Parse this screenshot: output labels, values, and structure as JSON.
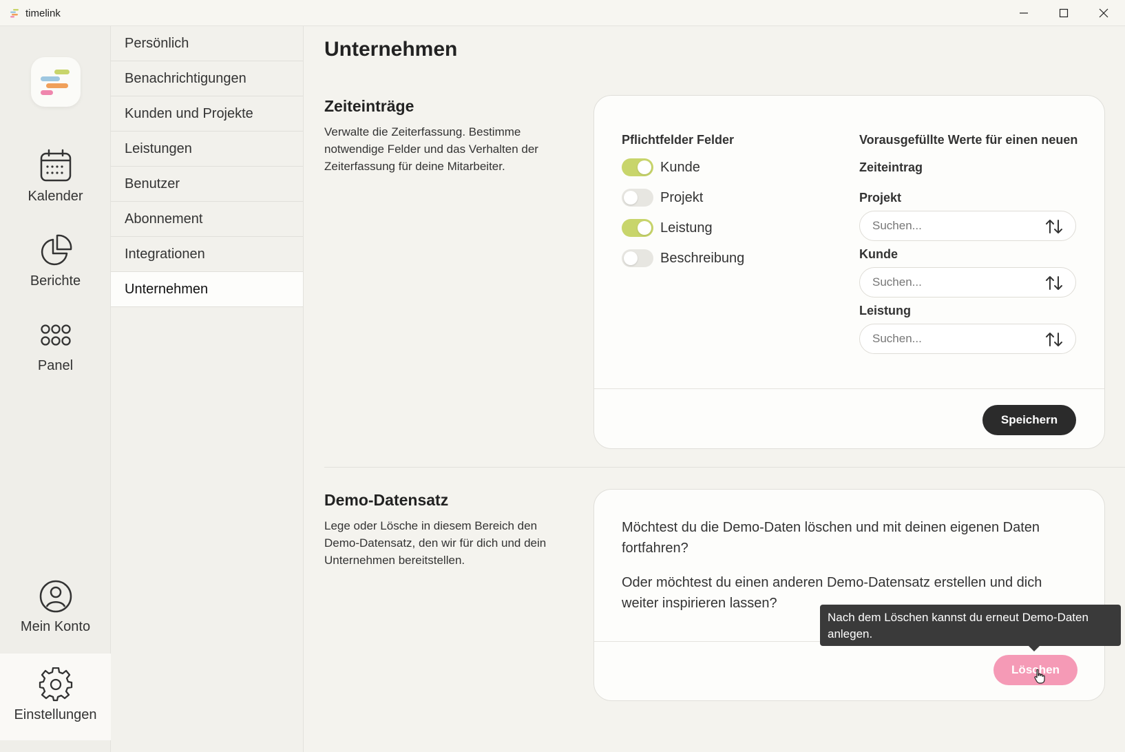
{
  "window": {
    "title": "timelink"
  },
  "rail": {
    "items": [
      {
        "label": "Kalender",
        "icon": "calendar-icon"
      },
      {
        "label": "Berichte",
        "icon": "pie-chart-icon"
      },
      {
        "label": "Panel",
        "icon": "grid-icon"
      },
      {
        "label": "Mein Konto",
        "icon": "user-circle-icon"
      },
      {
        "label": "Einstellungen",
        "icon": "gear-icon"
      }
    ]
  },
  "settings_nav": {
    "items": [
      "Persönlich",
      "Benachrichtigungen",
      "Kunden und Projekte",
      "Leistungen",
      "Benutzer",
      "Abonnement",
      "Integrationen",
      "Unternehmen"
    ],
    "active": "Unternehmen"
  },
  "main": {
    "title": "Unternehmen",
    "time_entries": {
      "title": "Zeiteinträge",
      "description": "Verwalte die Zeiterfassung. Bestimme notwendige Felder und das Verhalten der Zeiterfassung für deine Mitarbeiter.",
      "required_heading": "Pflichtfelder Felder",
      "toggles": [
        {
          "label": "Kunde",
          "on": true
        },
        {
          "label": "Projekt",
          "on": false
        },
        {
          "label": "Leistung",
          "on": true
        },
        {
          "label": "Beschreibung",
          "on": false
        }
      ],
      "prefill_heading_line1": "Vorausgefüllte Werte für einen neuen",
      "prefill_heading_line2": "Zeiteintrag",
      "fields": [
        {
          "label": "Projekt",
          "placeholder": "Suchen..."
        },
        {
          "label": "Kunde",
          "placeholder": "Suchen..."
        },
        {
          "label": "Leistung",
          "placeholder": "Suchen..."
        }
      ],
      "save_label": "Speichern"
    },
    "demo": {
      "title": "Demo-Datensatz",
      "description": "Lege oder Lösche in diesem Bereich den Demo-Datensatz, den wir für dich und dein Unternehmen bereitstellen.",
      "question1": "Möchtest du die Demo-Daten löschen und mit deinen eigenen Daten fortfahren?",
      "question2": "Oder möchtest du einen anderen Demo-Datensatz erstellen und dich weiter inspirieren lassen?",
      "delete_label": "Löschen",
      "tooltip": "Nach dem Löschen kannst du erneut Demo-Daten anlegen."
    }
  },
  "colors": {
    "toggle_on": "#c8d56b",
    "save_button": "#2b2b2b",
    "delete_button": "#f59ab6",
    "logo_green": "#c8d56b",
    "logo_blue": "#9ec7e0",
    "logo_orange": "#f0a05a",
    "logo_pink": "#ef86ad"
  }
}
